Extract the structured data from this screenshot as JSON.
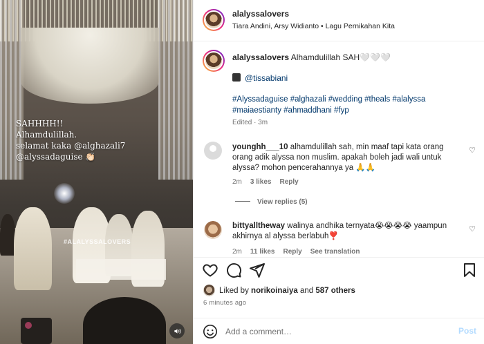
{
  "media": {
    "overlay_lines": [
      "SAHHHH!!",
      "Alhamdulillah.",
      "selamat kaka @alghazali7",
      "@alyssadaguise 👏🏻"
    ],
    "watermark": "#ALALYSSALOVERS",
    "sound_icon": "speaker-icon"
  },
  "header": {
    "username": "alalyssalovers",
    "subline": "Tiara Andini, Arsy Widianto • Lagu Pernikahan Kita"
  },
  "caption": {
    "username": "alalyssalovers",
    "text": "Alhamdulillah SAH🤍🤍🤍",
    "mention": "@tissabiani",
    "hashtags": "#Alyssadaguise #alghazali #wedding #theals #alalyssa #maiaestianty #ahmaddhani #fyp",
    "edited": "Edited · 3m"
  },
  "comments": [
    {
      "username": "younghh___10",
      "text": "alhamdulillah sah, min maaf tapi kata orang orang adik alyssa non muslim. apakah boleh jadi wali untuk alyssa? mohon pencerahannya ya 🙏🙏",
      "time": "2m",
      "likes": "3 likes",
      "reply": "Reply",
      "view_replies": "View replies (5)"
    },
    {
      "username": "bittyalltheway",
      "text": "walinya andhika ternyata😭😭😭😭 yaampun akhirnya al alyssa berlabuh❣️",
      "time": "2m",
      "likes": "11 likes",
      "reply": "Reply",
      "see_translation": "See translation"
    }
  ],
  "actions": {
    "liked_by_prefix": "Liked by ",
    "liked_by_user": "norikoinaiya",
    "liked_by_and": " and ",
    "liked_by_count": "587 others",
    "time": "6 minutes ago"
  },
  "comment_box": {
    "placeholder": "Add a comment…",
    "post_label": "Post"
  }
}
